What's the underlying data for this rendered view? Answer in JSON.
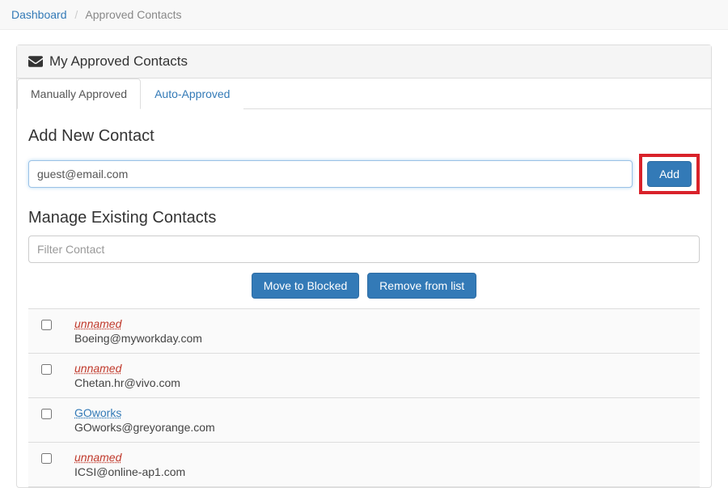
{
  "breadcrumb": {
    "dashboard": "Dashboard",
    "current": "Approved Contacts"
  },
  "panel": {
    "title": "My Approved Contacts"
  },
  "tabs": {
    "manual": "Manually Approved",
    "auto": "Auto-Approved"
  },
  "add": {
    "heading": "Add New Contact",
    "value": "guest@email.com",
    "button": "Add"
  },
  "manage": {
    "heading": "Manage Existing Contacts",
    "filter_placeholder": "Filter Contact",
    "move_blocked": "Move to Blocked",
    "remove": "Remove from list"
  },
  "contacts": [
    {
      "name": "unnamed",
      "email": "Boeing@myworkday.com",
      "is_link": false
    },
    {
      "name": "unnamed",
      "email": "Chetan.hr@vivo.com",
      "is_link": false
    },
    {
      "name": "GOworks",
      "email": "GOworks@greyorange.com",
      "is_link": true
    },
    {
      "name": "unnamed",
      "email": "ICSI@online-ap1.com",
      "is_link": false
    }
  ]
}
